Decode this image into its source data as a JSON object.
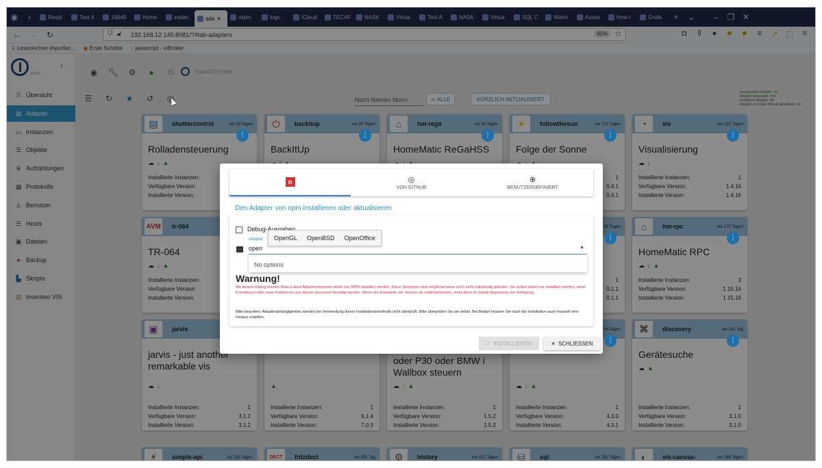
{
  "browser": {
    "tabs": [
      {
        "label": "Raspl"
      },
      {
        "label": "Test A"
      },
      {
        "label": "16849"
      },
      {
        "label": "Home"
      },
      {
        "label": "instan"
      },
      {
        "label": "ada",
        "active": true
      },
      {
        "label": "objec"
      },
      {
        "label": "logs -"
      },
      {
        "label": "iCloud"
      },
      {
        "label": "TECAF"
      },
      {
        "label": "NAS6"
      },
      {
        "label": "Virtua"
      },
      {
        "label": "Test A"
      },
      {
        "label": "NAS6"
      },
      {
        "label": "Virtua"
      },
      {
        "label": "SQL C"
      },
      {
        "label": "Wärm"
      },
      {
        "label": "Ausse"
      },
      {
        "label": "How t"
      },
      {
        "label": "Grafa"
      }
    ],
    "url": "192.168.12.145:8081/?#tab-adapters",
    "zoom": "90%",
    "bookmarks": [
      {
        "label": "Lesezeichen importier..."
      },
      {
        "label": "Erste Schritte"
      },
      {
        "label": "javascript - ioBroker"
      }
    ]
  },
  "app": {
    "version": "v6.3.5",
    "brand": "SMARTHOME",
    "sidebar": [
      {
        "label": "Übersicht",
        "icon": "grid-icon"
      },
      {
        "label": "Adapter",
        "icon": "store-icon",
        "active": true
      },
      {
        "label": "Instanzen",
        "icon": "instances-icon"
      },
      {
        "label": "Objekte",
        "icon": "objects-icon"
      },
      {
        "label": "Aufzählungen",
        "icon": "enums-icon"
      },
      {
        "label": "Protokolle",
        "icon": "logs-icon"
      },
      {
        "label": "Benutzer",
        "icon": "user-icon"
      },
      {
        "label": "Hosts",
        "icon": "hosts-icon"
      },
      {
        "label": "Dateien",
        "icon": "files-icon"
      },
      {
        "label": "Backup",
        "icon": "backup-icon"
      },
      {
        "label": "Skripte",
        "icon": "scripts-icon"
      },
      {
        "label": "inventwo VIS",
        "icon": "vis-icon"
      }
    ],
    "filter_placeholder": "Nach Namen filtern",
    "btn_alle": "ALLE",
    "btn_kurzlich": "KÜRZLICH AKTUALISIERT",
    "stats": {
      "selected": "Ausgewählte Adapter: 40",
      "total": "Adapter insgesamt: 473",
      "installed": "Installierte Adapter: 40",
      "updated": "Adapter im letzten Monat aktualisiert: 10"
    },
    "labels": {
      "installed_instances": "Installierte Instanzen:",
      "available_version": "Verfügbare Version:",
      "installed_version": "Installierte Version:"
    },
    "cards": [
      {
        "name": "shuttercontrol",
        "date": "vor 33 Tagen",
        "title": "Rolladensteuerung",
        "instances": "",
        "available": "",
        "installed": ""
      },
      {
        "name": "backitup",
        "date": "vor 39 Tagen",
        "title": "BackItUp",
        "instances": "",
        "available": "",
        "installed": ""
      },
      {
        "name": "hm-rega",
        "date": "vor 60 Tagen",
        "title": "HomeMatic ReGaHSS",
        "instances": "",
        "available": "",
        "installed": ""
      },
      {
        "name": "followthesun",
        "date": "vor 113 Tagen",
        "title": "Folge der Sonne",
        "instances": "1",
        "available": "0.4.1",
        "installed": "0.4.1"
      },
      {
        "name": "vis",
        "date": "vor 122 Tagen",
        "title": "Visualisierung",
        "instances": "1",
        "available": "1.4.16",
        "installed": "1.4.16"
      },
      {
        "name": "tr-064",
        "date": "",
        "title": "TR-064",
        "instances": "",
        "available": "",
        "installed": ""
      },
      {
        "name": "",
        "date": "59 Tagen",
        "title": "",
        "instances": "1",
        "available": "0.1.1",
        "installed": "0.1.1"
      },
      {
        "name": "hm-rpc",
        "date": "vor 172 Tagen",
        "title": "HomeMatic RPC",
        "instances": "3",
        "available": "1.15.16",
        "installed": "1.15.16"
      },
      {
        "name": "jarvis",
        "date": "",
        "title": "jarvis - just another remarkable vis",
        "instances": "1",
        "available": "3.1.2",
        "installed": "3.1.2"
      },
      {
        "name": "",
        "date": "",
        "title": "",
        "instances": "1",
        "available": "6.1.4",
        "installed": "7.0.3"
      },
      {
        "name": "",
        "date": "",
        "title": "oder P30 oder BMW i Wallbox steuern",
        "instances": "1",
        "available": "1.5.2",
        "installed": "1.5.2"
      },
      {
        "name": "",
        "date": "34 Tagen",
        "title": "",
        "instances": "1",
        "available": "4.3.0",
        "installed": "4.3.1"
      },
      {
        "name": "discovery",
        "date": "vor 231 Tag",
        "title": "Gerätesuche",
        "instances": "1",
        "available": "3.1.0",
        "installed": "3.1.0"
      },
      {
        "name": "simple-api",
        "date": "vor 233 Tagen",
        "title": ""
      },
      {
        "name": "fritzdect",
        "date": "vor 251 Tag",
        "title": ""
      },
      {
        "name": "history",
        "date": "vor 252 Tagen",
        "title": ""
      },
      {
        "name": "sql",
        "date": "vor 252 Tagen",
        "title": ""
      },
      {
        "name": "vis-canvas-",
        "date": "vor 266 Tagen",
        "title": ""
      }
    ]
  },
  "dialog": {
    "tabs": [
      {
        "label": "",
        "icon": "npm-icon",
        "active": true
      },
      {
        "label": "VON GITHUB",
        "icon": "github-icon"
      },
      {
        "label": "BENUTZERDEFINIERT",
        "icon": "globe-icon"
      }
    ],
    "heading": "Den Adapter von npm installieren oder aktualisieren",
    "debug_label": "Debug-Ausgaben",
    "adapter_label": "Adapter",
    "adapter_value": "open",
    "no_options": "No options",
    "suggestions": [
      "OpenGL",
      "OpenBSD",
      "OpenOffice"
    ],
    "warning_title": "Warnung!",
    "warning_text": "Mit diesem Dialog können Beta-/Latest Adapterversionen direkt von NPM installiert werden. Diese Versionen sind möglicherweise noch nicht vollständig getestet. Sie sollten daher nur installiert werden, wenn Korrekturen oder neue Funktionen aus diesen Versionen benötigt werden. Wenn der Entwickler die Version als stabil betrachtet, steht diese im Stable-Repository zur Verfügung.",
    "note_text": "Bitte beachten: Adapterabhängigkeiten werden bei Verwendung dieser Installationsmethode nicht überprüft. Bitte überprüfen Sie sie selbst. Bei Bedarf müssen Sie nach der Installation auch manuell eine Instanz erstellen.",
    "install_label": "INSTALLIEREN",
    "close_label": "SCHLIESSEN"
  }
}
